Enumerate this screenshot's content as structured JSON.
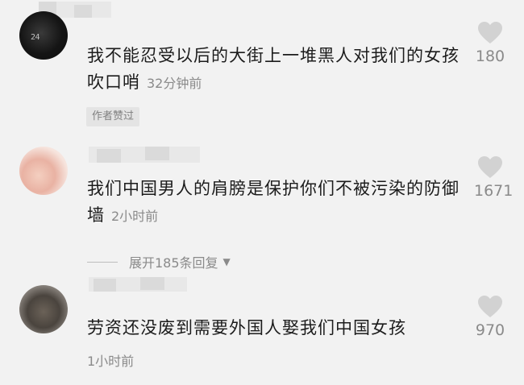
{
  "comments": [
    {
      "avatar_label": "24",
      "text": "我不能忍受以后的大街上一堆黑人对我们的女孩吹口哨",
      "time": "32分钟前",
      "author_tag": "作者赞过",
      "likes": "180"
    },
    {
      "text": "我们中国男人的肩膀是保护你们不被污染的防御墙",
      "time": "2小时前",
      "likes": "1671",
      "reply_toggle": "展开185条回复"
    },
    {
      "text": "劳资还没废到需要外国人娶我们中国女孩",
      "time": "1小时前",
      "likes": "970"
    }
  ]
}
